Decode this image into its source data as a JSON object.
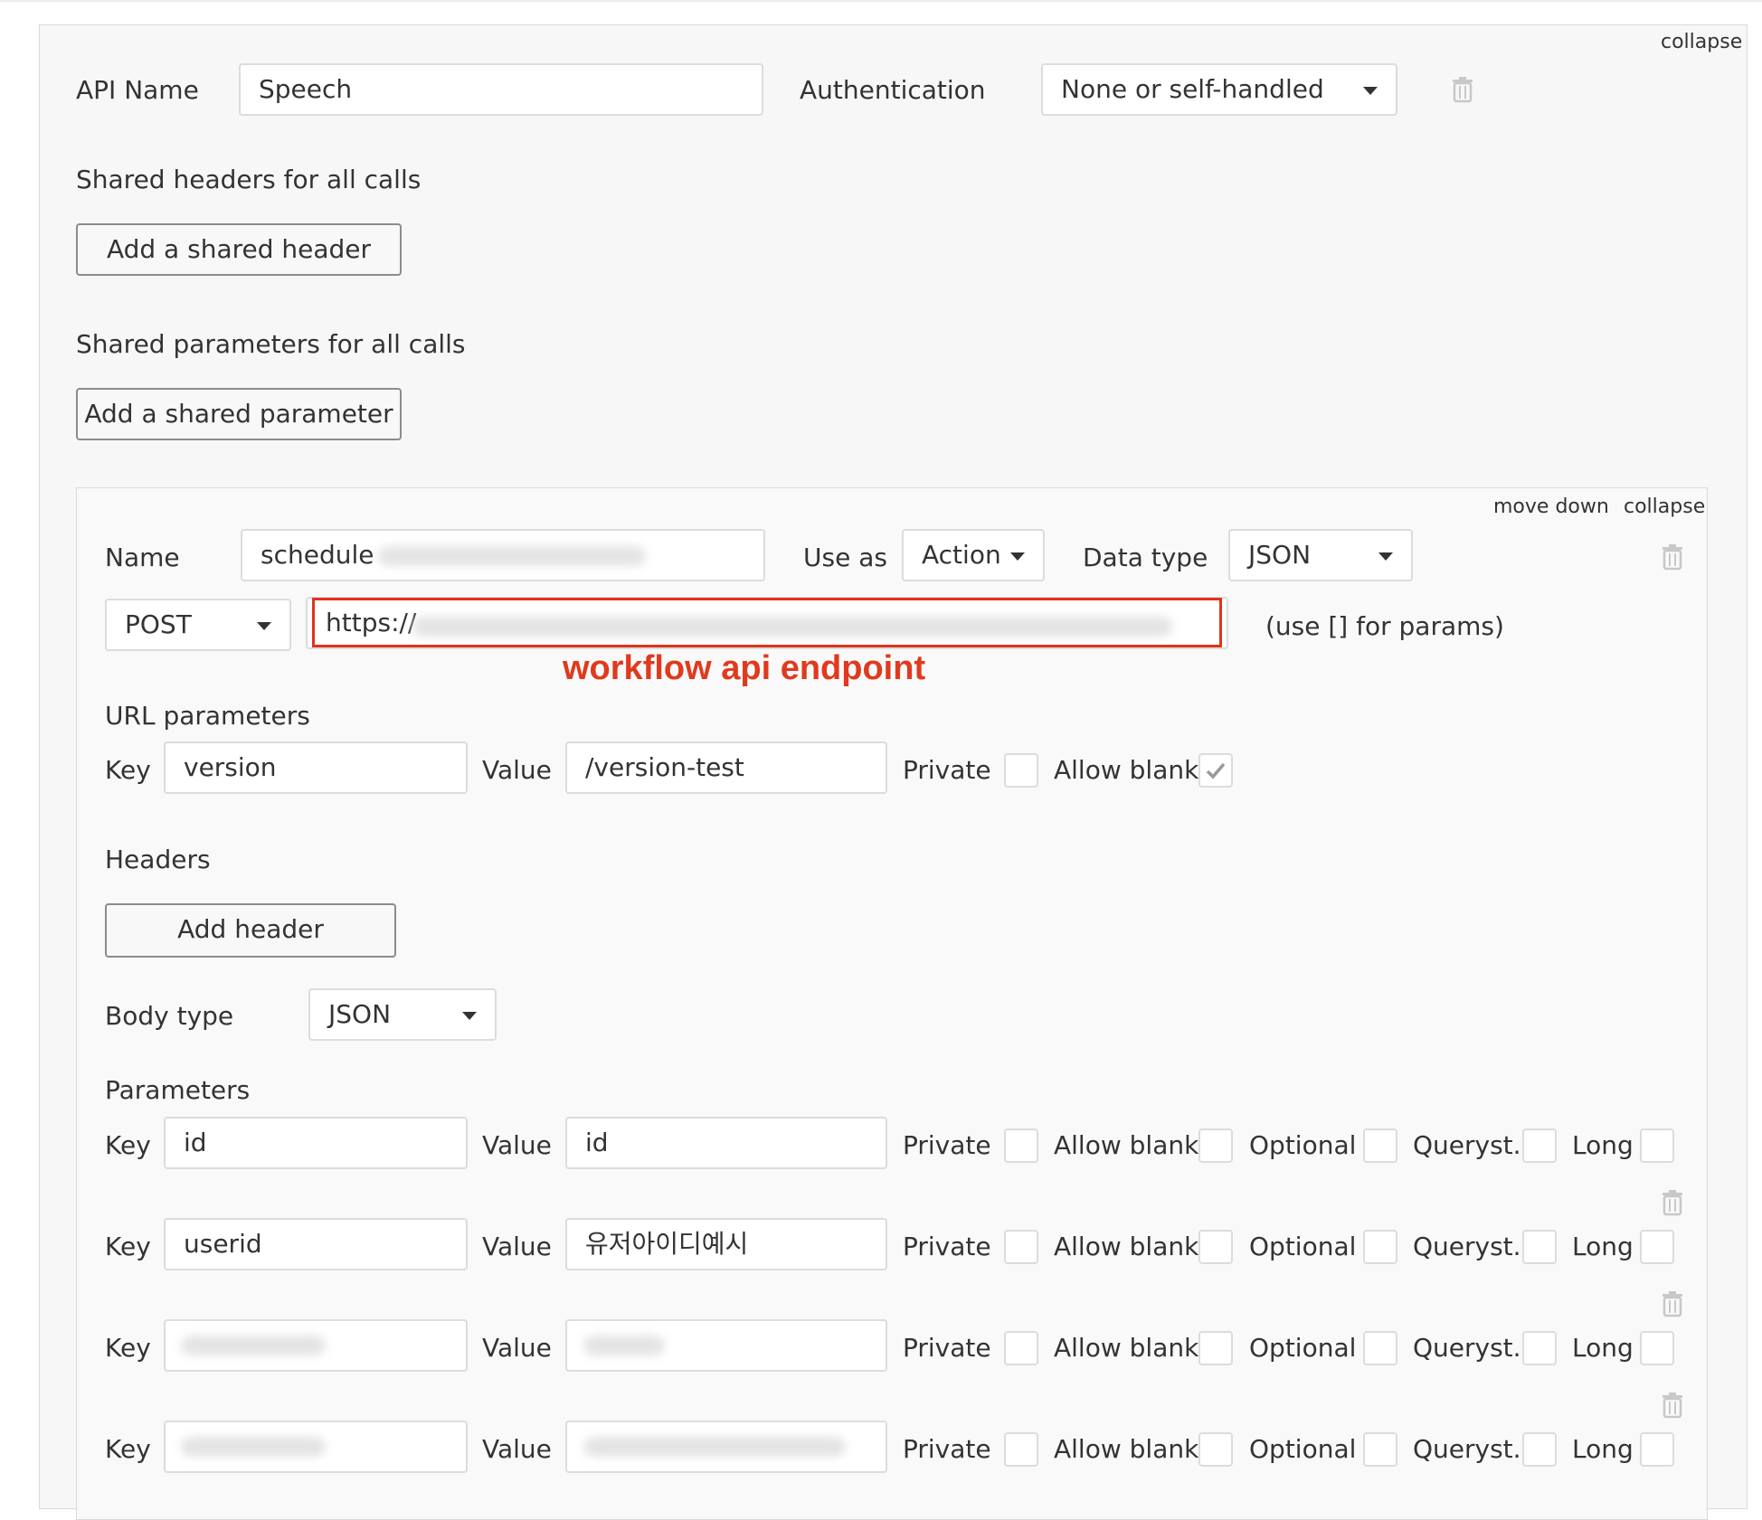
{
  "api": {
    "collapse_label": "collapse",
    "name_label": "API Name",
    "name_value": "Speech",
    "auth_label": "Authentication",
    "auth_value": "None or self-handled",
    "shared_headers_label": "Shared headers for all calls",
    "add_shared_header_label": "Add a shared header",
    "shared_params_label": "Shared parameters for all calls",
    "add_shared_param_label": "Add a shared parameter"
  },
  "call": {
    "move_down_label": "move down",
    "collapse_label": "collapse",
    "name_label": "Name",
    "name_value": "schedule",
    "use_as_label": "Use as",
    "use_as_value": "Action",
    "data_type_label": "Data type",
    "data_type_value": "JSON",
    "method_value": "POST",
    "url_value": "https://",
    "url_hint": "(use [] for params)",
    "annotation": "workflow api endpoint",
    "url_params_label": "URL parameters",
    "headers_label": "Headers",
    "add_header_label": "Add header",
    "body_type_label": "Body type",
    "body_type_value": "JSON",
    "parameters_label": "Parameters"
  },
  "field_labels": {
    "key": "Key",
    "value": "Value",
    "private": "Private",
    "allow_blank": "Allow blank",
    "optional": "Optional",
    "queryst": "Queryst.",
    "long": "Long"
  },
  "url_param": {
    "key": "version",
    "value": "/version-test",
    "private": false,
    "allow_blank": true
  },
  "params": [
    {
      "key": "id",
      "value": "id"
    },
    {
      "key": "userid",
      "value": "유저아이디예시"
    },
    {
      "key": "",
      "value": ""
    },
    {
      "key": "",
      "value": ""
    }
  ],
  "colors": {
    "highlight": "#e0331c",
    "panel_bg": "#f7f7f7",
    "border": "#dcdcdc"
  }
}
